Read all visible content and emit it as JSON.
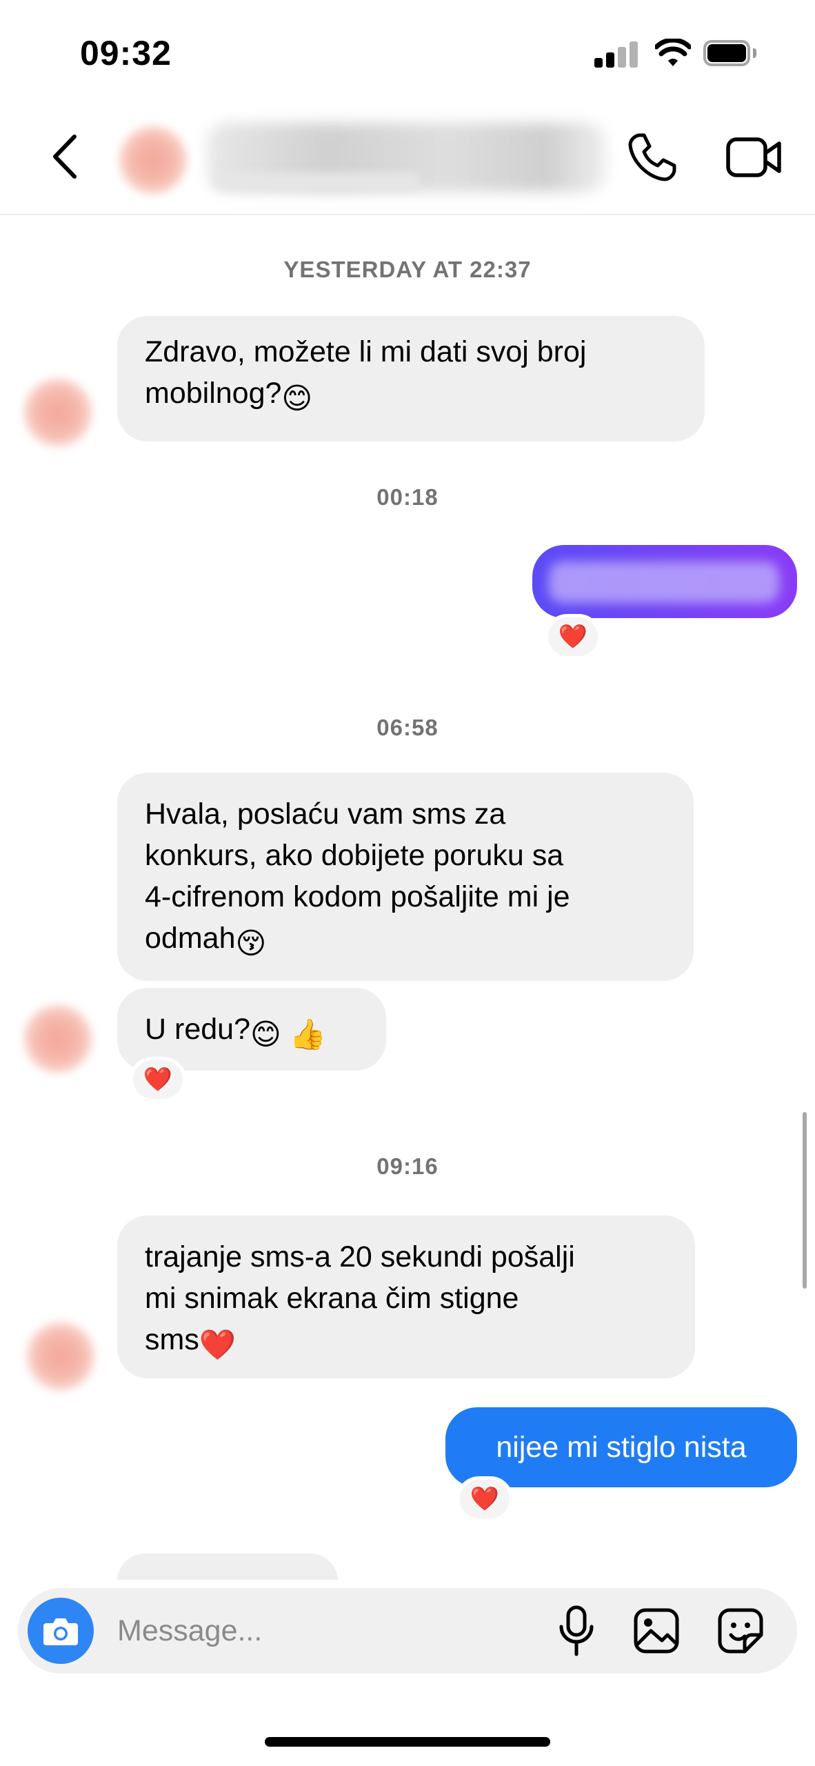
{
  "status_bar": {
    "time": "09:32"
  },
  "header": {
    "back_icon": "chevron-left-icon",
    "call_icon": "phone-icon",
    "video_icon": "video-camera-icon"
  },
  "messages": [
    {
      "type": "timestamp",
      "text": "YESTERDAY AT 22:37"
    },
    {
      "type": "incoming",
      "lines": [
        "Zdravo, možete li mi dati svoj broj",
        "mobilnog?"
      ],
      "trailing_emoji": "😊"
    },
    {
      "type": "timestamp",
      "text": "00:18"
    },
    {
      "type": "outgoing",
      "redacted": true,
      "reaction": "❤️"
    },
    {
      "type": "timestamp",
      "text": "06:58"
    },
    {
      "type": "incoming",
      "lines": [
        "Hvala, poslaću vam sms za",
        "konkurs, ako dobijete poruku sa",
        "4-cifrenom kodom pošaljite mi je",
        "odmah"
      ],
      "trailing_emoji": "😚"
    },
    {
      "type": "incoming",
      "text": "U redu?",
      "trailing_emoji": "😊 👍",
      "reaction": "❤️"
    },
    {
      "type": "timestamp",
      "text": "09:16"
    },
    {
      "type": "incoming",
      "lines": [
        "trajanje sms-a 20 sekundi pošalji",
        "mi snimak ekrana čim stigne",
        "sms"
      ],
      "trailing_emoji": "❤️"
    },
    {
      "type": "outgoing",
      "text": "nijee mi stiglo nista",
      "reaction": "❤️"
    }
  ],
  "composer": {
    "placeholder": "Message..."
  },
  "colors": {
    "outgoing_gradient_start": "#5b4cf6",
    "outgoing_gradient_end": "#8a3cf5",
    "outgoing_blue": "#1f7cf4",
    "camera_button": "#2e86f5",
    "incoming_bubble": "#efefef"
  }
}
